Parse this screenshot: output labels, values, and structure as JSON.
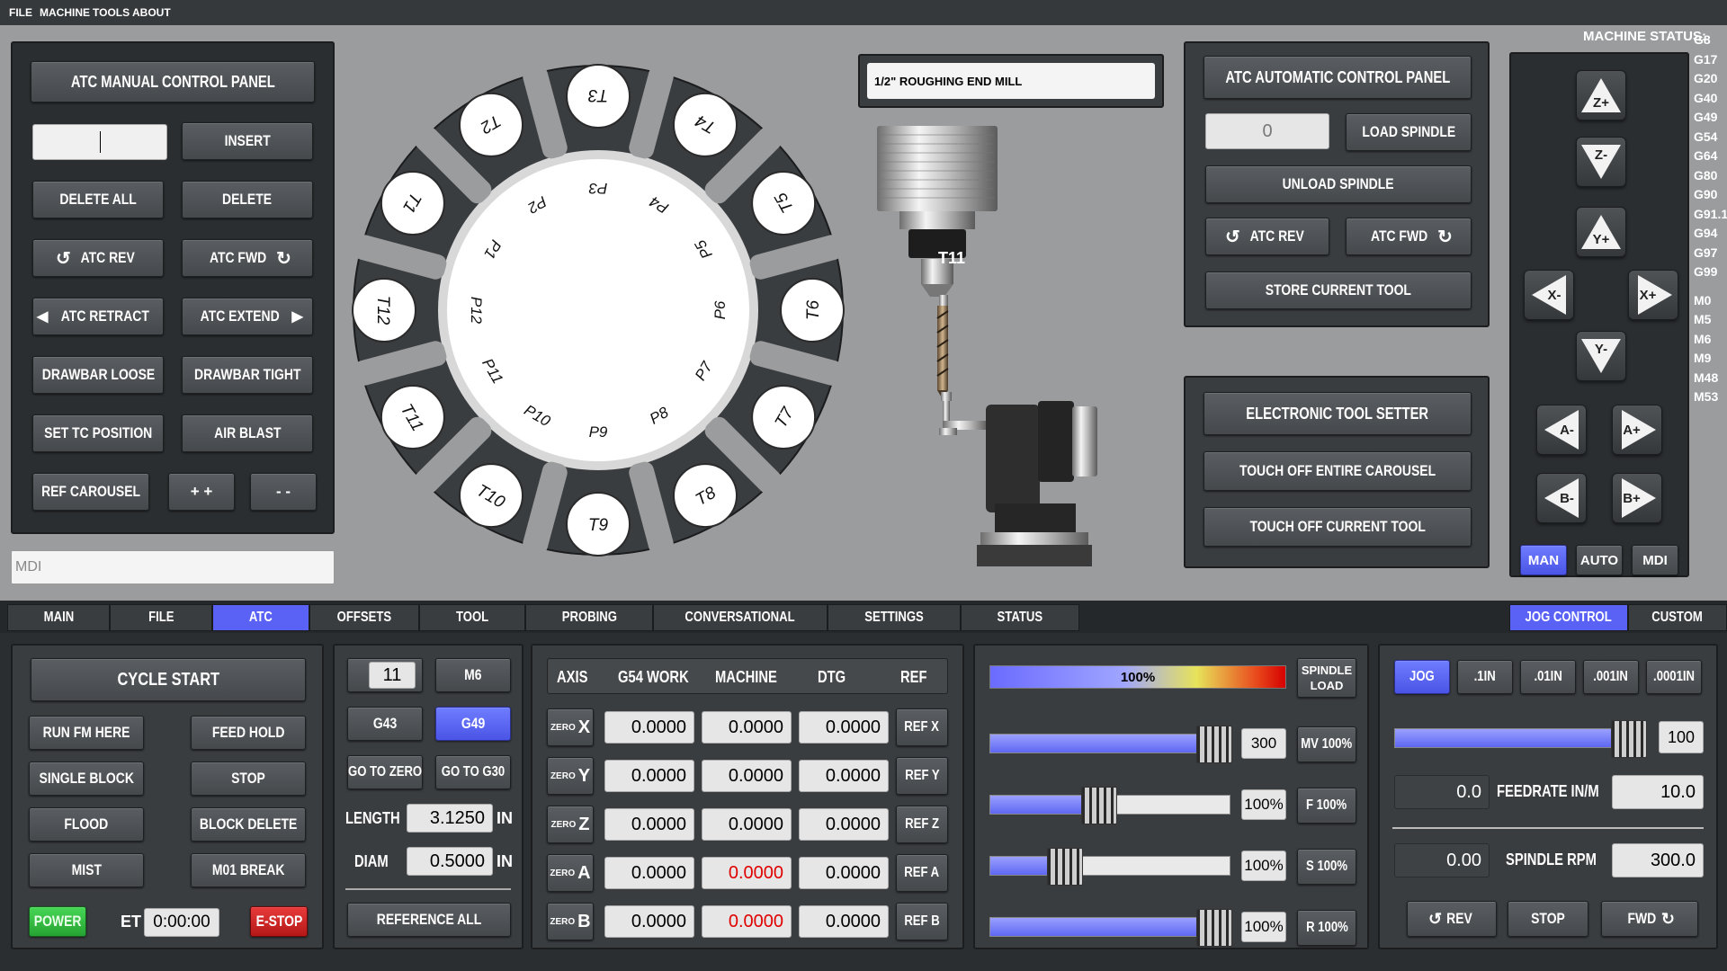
{
  "menu": [
    "FILE",
    "MACHINE",
    "TOOLS",
    "ABOUT"
  ],
  "atc_manual": {
    "title": "ATC MANUAL CONTROL PANEL",
    "input_value": "",
    "insert": "INSERT",
    "delete_all": "DELETE ALL",
    "delete": "DELETE",
    "atc_rev": "ATC REV",
    "atc_fwd": "ATC FWD",
    "atc_retract": "ATC RETRACT",
    "atc_extend": "ATC EXTEND",
    "drawbar_loose": "DRAWBAR LOOSE",
    "drawbar_tight": "DRAWBAR TIGHT",
    "set_tc_position": "SET TC POSITION",
    "air_blast": "AIR BLAST",
    "ref_carousel": "REF CAROUSEL",
    "plus": "+ +",
    "minus": "- -"
  },
  "mdi": {
    "placeholder": "MDI"
  },
  "carousel": {
    "tools": [
      "T3",
      "T4",
      "T5",
      "T6",
      "T7",
      "T8",
      "T9",
      "T10",
      "T11",
      "T12",
      "T1",
      "T2"
    ],
    "pockets": [
      "P3",
      "P4",
      "P5",
      "P6",
      "P7",
      "P8",
      "P9",
      "P10",
      "P11",
      "P12",
      "P1",
      "P2"
    ]
  },
  "tool_description": "1/2\" ROUGHING END MILL",
  "spindle_tool": "T11",
  "atc_auto": {
    "title": "ATC AUTOMATIC CONTROL PANEL",
    "value": "0",
    "load_spindle": "LOAD SPINDLE",
    "unload_spindle": "UNLOAD SPINDLE",
    "atc_rev": "ATC REV",
    "atc_fwd": "ATC FWD",
    "store_current_tool": "STORE CURRENT TOOL"
  },
  "tool_setter": {
    "title": "ELECTRONIC TOOL SETTER",
    "touch_carousel": "TOUCH OFF ENTIRE CAROUSEL",
    "touch_current": "TOUCH OFF CURRENT TOOL"
  },
  "machine_status": {
    "label": "MACHINE STATUS:",
    "codes": [
      "G8",
      "G17",
      "G20",
      "G40",
      "G49",
      "G54",
      "G64",
      "G80",
      "G90",
      "G91.1",
      "G94",
      "G97",
      "G99",
      "M0",
      "M5",
      "M6",
      "M9",
      "M48",
      "M53"
    ]
  },
  "jog_pad": {
    "z_plus": "Z+",
    "z_minus": "Z-",
    "y_plus": "Y+",
    "y_minus": "Y-",
    "x_minus": "X-",
    "x_plus": "X+",
    "a_minus": "A-",
    "a_plus": "A+",
    "b_minus": "B-",
    "b_plus": "B+",
    "modes": [
      "MAN",
      "AUTO",
      "MDI"
    ],
    "active_mode": "MAN"
  },
  "tabs": [
    "MAIN",
    "FILE",
    "ATC",
    "OFFSETS",
    "TOOL",
    "PROBING",
    "CONVERSATIONAL",
    "SETTINGS",
    "STATUS"
  ],
  "active_tab": "ATC",
  "right_tabs": [
    "JOG CONTROL",
    "CUSTOM"
  ],
  "active_right_tab": "JOG CONTROL",
  "cycle": {
    "cycle_start": "CYCLE START",
    "run_from_here": "RUN FM HERE",
    "feed_hold": "FEED HOLD",
    "single_block": "SINGLE BLOCK",
    "stop": "STOP",
    "flood": "FLOOD",
    "block_delete": "BLOCK DELETE",
    "mist": "MIST",
    "m01_break": "M01 BREAK",
    "power": "POWER",
    "et_label": "ET",
    "et_value": "0:00:00",
    "estop": "E-STOP"
  },
  "tool_panel": {
    "t_label": "T",
    "t_value": "11",
    "m6": "M6",
    "g43": "G43",
    "g49": "G49",
    "go_to_zero": "GO TO ZERO",
    "go_to_g30": "GO TO G30",
    "length_label": "LENGTH",
    "length_value": "3.1250",
    "length_unit": "IN",
    "diam_label": "DIAM",
    "diam_value": "0.5000",
    "diam_unit": "IN",
    "reference_all": "REFERENCE ALL"
  },
  "dro": {
    "headers": [
      "AXIS",
      "G54 WORK",
      "MACHINE",
      "DTG",
      "REF"
    ],
    "zero_label": "ZERO",
    "rows": [
      {
        "axis": "X",
        "work": "0.0000",
        "machine": "0.0000",
        "dtg": "0.0000",
        "ref": "REF X",
        "machine_alert": false
      },
      {
        "axis": "Y",
        "work": "0.0000",
        "machine": "0.0000",
        "dtg": "0.0000",
        "ref": "REF Y",
        "machine_alert": false
      },
      {
        "axis": "Z",
        "work": "0.0000",
        "machine": "0.0000",
        "dtg": "0.0000",
        "ref": "REF Z",
        "machine_alert": false
      },
      {
        "axis": "A",
        "work": "0.0000",
        "machine": "0.0000",
        "dtg": "0.0000",
        "ref": "REF A",
        "machine_alert": true
      },
      {
        "axis": "B",
        "work": "0.0000",
        "machine": "0.0000",
        "dtg": "0.0000",
        "ref": "REF B",
        "machine_alert": true
      }
    ],
    "alert_color": "#e00000"
  },
  "overrides": {
    "spindle_load_pct": "100%",
    "spindle_load_fraction": 1.0,
    "spindle_load_label": "SPINDLE LOAD",
    "sliders": [
      {
        "value": "300",
        "button": "MV 100%",
        "fraction": 0.93
      },
      {
        "value": "100%",
        "button": "F 100%",
        "fraction": 0.45
      },
      {
        "value": "100%",
        "button": "S 100%",
        "fraction": 0.31
      },
      {
        "value": "100%",
        "button": "R 100%",
        "fraction": 0.93
      }
    ]
  },
  "jog_control": {
    "increments": [
      "JOG",
      ".1IN",
      ".01IN",
      ".001IN",
      ".0001IN"
    ],
    "active_increment": "JOG",
    "jog_speed": "100",
    "jog_fraction": 0.93,
    "feed_actual": "0.0",
    "feed_label": "FEEDRATE IN/M",
    "feed_value": "10.0",
    "spindle_actual": "0.00",
    "spindle_label": "SPINDLE RPM",
    "spindle_value": "300.0",
    "rev": "REV",
    "stop": "STOP",
    "fwd": "FWD"
  },
  "colors": {
    "accent": "#5962f5",
    "power": "#2fbf3c",
    "estop": "#d01f1f"
  }
}
